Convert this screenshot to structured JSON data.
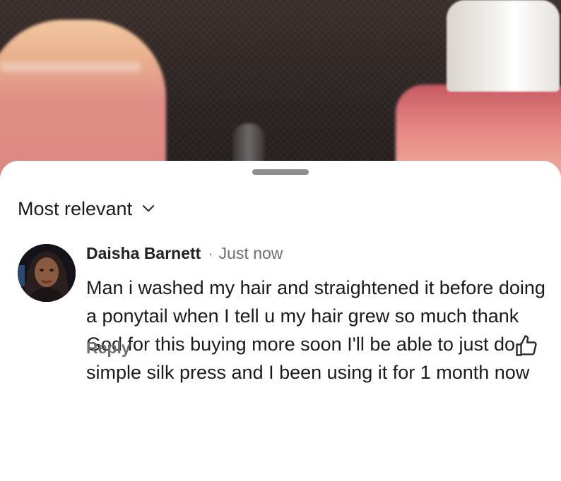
{
  "sort": {
    "label": "Most relevant"
  },
  "comment": {
    "author": "Daisha Barnett",
    "separator": "·",
    "timestamp": "Just now",
    "text": "Man i washed my hair and straightened it before doing a ponytail when I tell u my hair grew so much thank God for this buying more soon I'll be able to just do simple silk press and I been using it for 1 month now",
    "reply_label": "Reply"
  },
  "icons": {
    "sort": "chevron-down-icon",
    "like": "thumbs-up-icon"
  }
}
